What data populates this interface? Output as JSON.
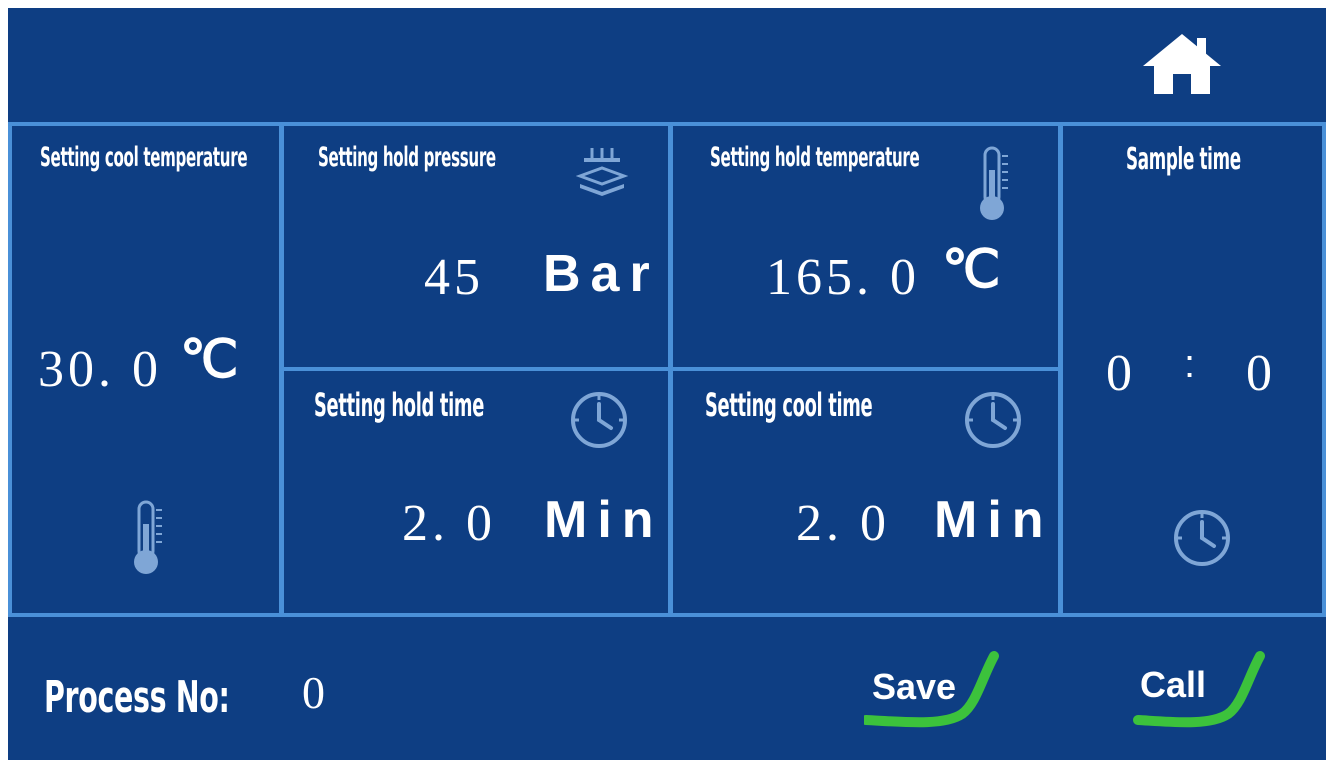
{
  "header": {
    "home_icon": "home-icon"
  },
  "cool_temperature": {
    "title": "Setting cool temperature",
    "value": "30. 0",
    "unit": "℃",
    "icon": "thermometer-icon"
  },
  "hold_pressure": {
    "title": "Setting hold pressure",
    "value": "45",
    "unit": "Bar",
    "icon": "press-icon"
  },
  "hold_temperature": {
    "title": "Setting hold temperature",
    "value": "165. 0",
    "unit": "℃",
    "icon": "thermometer-icon"
  },
  "sample_time": {
    "title": "Sample time",
    "minutes": "0",
    "separator": ":",
    "seconds": "0",
    "icon": "clock-icon"
  },
  "hold_time": {
    "title": "Setting hold time",
    "value": "2. 0",
    "unit": "Min",
    "icon": "clock-icon"
  },
  "cool_time": {
    "title": "Setting cool time",
    "value": "2. 0",
    "unit": "Min",
    "icon": "clock-icon"
  },
  "footer": {
    "process_label": "Process No:",
    "process_value": "0",
    "save_label": "Save",
    "call_label": "Call"
  },
  "colors": {
    "background": "#0e3e83",
    "grid": "#4a90d8",
    "accent": "#3cc23c",
    "icon_dim": "#7fa6d6"
  }
}
